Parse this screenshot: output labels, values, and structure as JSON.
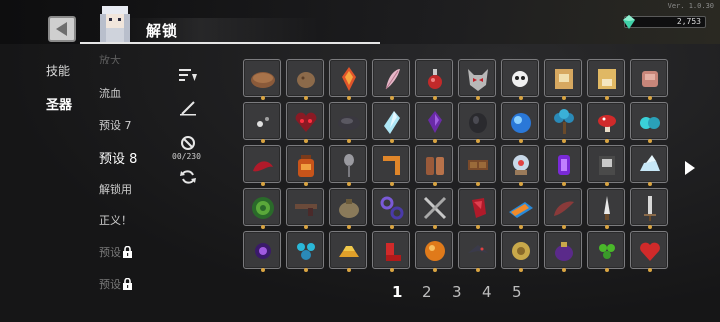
{
  "header": {
    "title": "解锁",
    "version": "Ver. 1.0.30",
    "currency_value": "2,753"
  },
  "categories": [
    {
      "label": "技能",
      "active": false
    },
    {
      "label": "圣器",
      "active": true
    }
  ],
  "presets": [
    {
      "label": "放大",
      "state": "faded"
    },
    {
      "label": "流血",
      "state": "normal"
    },
    {
      "label": "预设 7",
      "state": "normal"
    },
    {
      "label": "预设 8",
      "state": "active"
    },
    {
      "label": "解锁用",
      "state": "normal"
    },
    {
      "label": "正义！",
      "state": "normal"
    },
    {
      "label": "预设",
      "state": "locked"
    },
    {
      "label": "预设",
      "state": "locked"
    }
  ],
  "tools": {
    "count": "00/230"
  },
  "grid": {
    "rows": [
      [
        "bread",
        "potato",
        "fire-crystal",
        "feather",
        "potion",
        "demon-mask",
        "skull-pill",
        "scroll-box",
        "scroll-box-2",
        "meat"
      ],
      [
        "bug",
        "heart-demon",
        "dark-stone",
        "ice-shard",
        "purple-gem",
        "black-ore",
        "blue-crystal",
        "blue-tree",
        "red-mushroom",
        "cyan-rings"
      ],
      [
        "red-tongue",
        "amber-jar",
        "spoon",
        "boomerang",
        "gloves",
        "chocolate",
        "snow-globe",
        "purple-lantern",
        "book",
        "ice-ship"
      ],
      [
        "green-shield",
        "gun",
        "sack",
        "chain",
        "crossed-swords",
        "red-gem",
        "orange-blade",
        "red-wing",
        "white-blade",
        "silver-sword"
      ],
      [
        "purple-eye",
        "blue-flower",
        "gold-bars",
        "red-boot",
        "orange-orb",
        "dark-bird",
        "yellow-flower",
        "purple-bag",
        "green-clover",
        "red-heart"
      ]
    ]
  },
  "pagination": {
    "pages": [
      "1",
      "2",
      "3",
      "4",
      "5"
    ],
    "active": "1"
  },
  "colors": {
    "accent": "#d9a441",
    "slot_bg": "#3a3a3c",
    "slot_border": "#7b7b7e",
    "gem": "#3fd1a8"
  }
}
